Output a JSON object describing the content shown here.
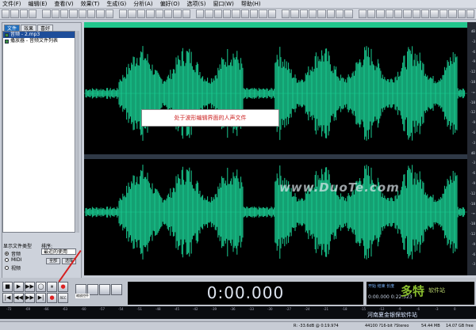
{
  "menubar": {
    "items": [
      "文件(F)",
      "编辑(E)",
      "查看(V)",
      "效果(T)",
      "生成(G)",
      "分析(A)",
      "偏好(O)",
      "选项(S)",
      "窗口(W)",
      "帮助(H)"
    ]
  },
  "left_panel": {
    "tabs": [
      "文件",
      "效果",
      "喜好"
    ],
    "files": [
      {
        "name": "音频 - 2.mp3",
        "selected": true
      },
      {
        "name": "播放器 - 音频文件列表",
        "selected": false
      }
    ],
    "display_type_label": "显示文件类型",
    "sort_label": "排序:",
    "radio_options": [
      {
        "label": "音频",
        "selected": true
      },
      {
        "label": "MIDI",
        "selected": false
      },
      {
        "label": "视频",
        "selected": false
      }
    ],
    "sort_value": "最近的使用",
    "buttons": [
      "全部",
      "选择"
    ]
  },
  "waveform": {
    "top_bar_color": "#22c78d",
    "wave_color": "#19c98f",
    "annotation": "处于波形编辑界面的人声文件",
    "watermark": "www.DuoTe.com",
    "ruler_labels": [
      "dB",
      "-3",
      "-6",
      "-9",
      "-12",
      "-18",
      "-∞",
      "-18",
      "-12",
      "-9",
      "-6",
      "-3",
      "dB",
      "-3",
      "-6",
      "-9",
      "-12",
      "-18",
      "-∞",
      "-18",
      "-12",
      "-9",
      "-6",
      "-3"
    ]
  },
  "transport": {
    "buttons": [
      "■",
      "▶",
      "▶▶",
      "◯",
      "⏸",
      "●",
      "|◀",
      "◀◀",
      "▶▶",
      "▶|",
      "●",
      "REC"
    ]
  },
  "zoom": {
    "label": "缩放控件"
  },
  "clock": {
    "time": "0:00.000"
  },
  "right_box": {
    "top_text": "开始 结束 长度",
    "bottom_text": "0:00.000  0:22.523",
    "logo_text": "多特",
    "logo_sub": "软件站"
  },
  "level_meter": {
    "ticks": [
      "-72",
      "-69",
      "-66",
      "-63",
      "-60",
      "-57",
      "-54",
      "-51",
      "-48",
      "-45",
      "-42",
      "-39",
      "-36",
      "-33",
      "-30",
      "-27",
      "-24",
      "-21",
      "-18",
      "-15",
      "-12",
      "-9",
      "-6",
      "-3",
      "0"
    ]
  },
  "statusbar": {
    "db_info": "R: -33.6dB @ 0:19.974",
    "format": "44100 ?16-bit ?Stereo",
    "size": "54.44 MB",
    "free": "14.07 GB free",
    "overlay": "河南夏金银保软件站"
  }
}
